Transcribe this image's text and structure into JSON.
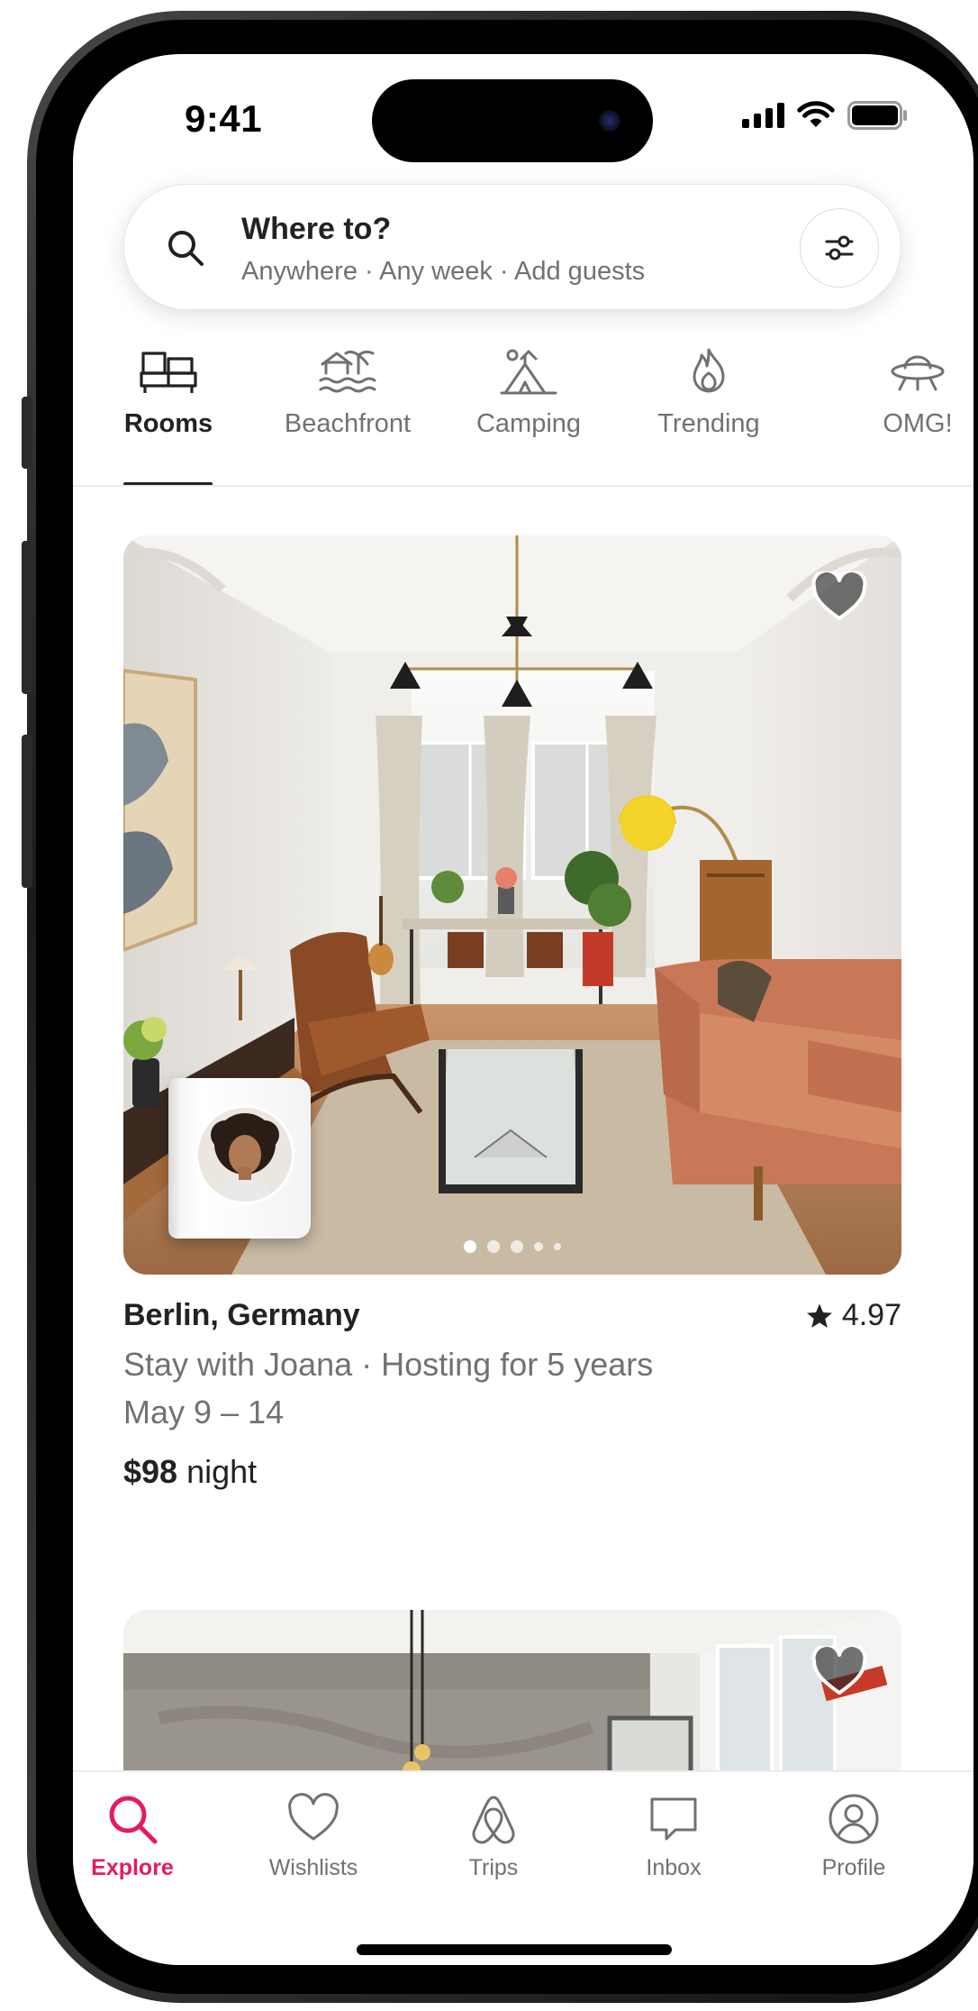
{
  "status_bar": {
    "time": "9:41"
  },
  "search": {
    "title": "Where to?",
    "subtitle": "Anywhere · Any week · Add guests",
    "icon": "search-icon",
    "filter_icon": "filter-icon"
  },
  "categories": [
    {
      "label": "Rooms",
      "icon": "rooms-icon",
      "active": true
    },
    {
      "label": "Beachfront",
      "icon": "beachfront-icon",
      "active": false
    },
    {
      "label": "Camping",
      "icon": "camping-icon",
      "active": false
    },
    {
      "label": "Trending",
      "icon": "trending-flame-icon",
      "active": false
    },
    {
      "label": "OMG!",
      "icon": "omg-ufo-icon",
      "active": false
    }
  ],
  "listing": {
    "location": "Berlin, Germany",
    "rating": "4.97",
    "subtitle": "Stay with Joana · Hosting for 5 years",
    "dates": "May 9 – 14",
    "price": "$98",
    "price_unit": "night",
    "photo_count": 5,
    "active_photo": 1
  },
  "nav": [
    {
      "label": "Explore",
      "icon": "search-icon",
      "active": true
    },
    {
      "label": "Wishlists",
      "icon": "heart-icon",
      "active": false
    },
    {
      "label": "Trips",
      "icon": "airbnb-logo-icon",
      "active": false
    },
    {
      "label": "Inbox",
      "icon": "message-icon",
      "active": false
    },
    {
      "label": "Profile",
      "icon": "profile-icon",
      "active": false
    }
  ],
  "colors": {
    "accent": "#e31c5f",
    "text": "#222222",
    "muted": "#717171"
  }
}
